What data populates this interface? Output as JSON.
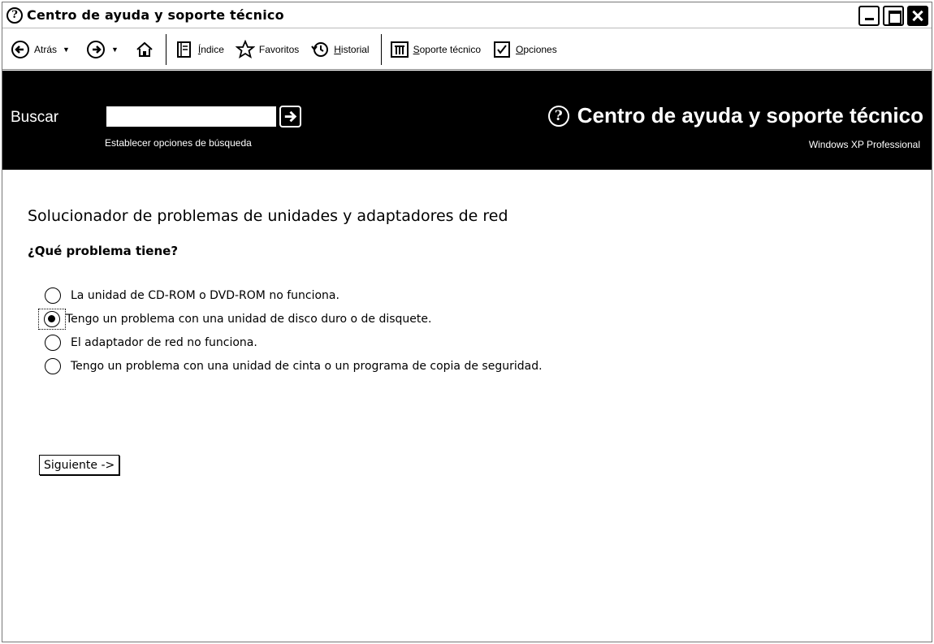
{
  "window": {
    "title": "Centro de ayuda y soporte técnico",
    "icon": "help-circle-icon"
  },
  "toolbar": {
    "back_label": "Atrás",
    "index_label": "Índice",
    "favorites_label": "Favoritos",
    "history_label": "Historial",
    "support_label": "Soporte técnico",
    "options_label": "Opciones"
  },
  "search": {
    "label": "Buscar",
    "value": "",
    "options_link": "Establecer opciones de búsqueda"
  },
  "brand": {
    "title": "Centro de ayuda y soporte técnico",
    "edition": "Windows XP Professional"
  },
  "main": {
    "title": "Solucionador de problemas de unidades y adaptadores de red",
    "question": "¿Qué problema tiene?",
    "options": [
      {
        "label": "La unidad de CD-ROM o DVD-ROM no funciona.",
        "checked": false
      },
      {
        "label": "Tengo un problema con una unidad de disco duro o de disquete.",
        "checked": true
      },
      {
        "label": "El adaptador de red no funciona.",
        "checked": false
      },
      {
        "label": "Tengo un problema con una unidad de cinta o un programa de copia de seguridad.",
        "checked": false
      }
    ],
    "next_label": "Siguiente ->"
  }
}
